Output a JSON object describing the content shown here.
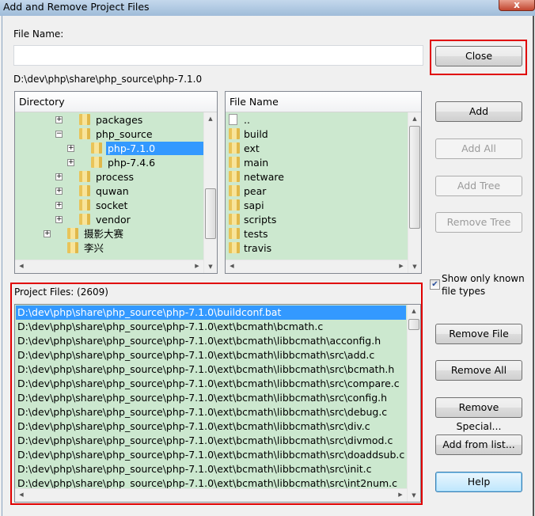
{
  "window": {
    "title": "Add and Remove Project Files",
    "close_glyph": "x"
  },
  "file_name": {
    "label": "File Name:",
    "value": ""
  },
  "current_path": "D:\\dev\\php\\share\\php_source\\php-7.1.0",
  "directory": {
    "header": "Directory",
    "items": [
      {
        "label": "packages",
        "level": 3,
        "expander": "+"
      },
      {
        "label": "php_source",
        "level": 3,
        "expander": "-"
      },
      {
        "label": "php-7.1.0",
        "level": 4,
        "expander": "+",
        "selected": true
      },
      {
        "label": "php-7.4.6",
        "level": 4,
        "expander": "+"
      },
      {
        "label": "process",
        "level": 3,
        "expander": "+"
      },
      {
        "label": "quwan",
        "level": 3,
        "expander": "+"
      },
      {
        "label": "socket",
        "level": 3,
        "expander": "+"
      },
      {
        "label": "vendor",
        "level": 3,
        "expander": "+"
      },
      {
        "label": "摄影大赛",
        "level": 2,
        "expander": "+"
      },
      {
        "label": "李兴",
        "level": 2,
        "expander": ""
      }
    ]
  },
  "files": {
    "header": "File Name",
    "items": [
      {
        "label": "..",
        "icon": "file"
      },
      {
        "label": "build",
        "icon": "folder"
      },
      {
        "label": "ext",
        "icon": "folder"
      },
      {
        "label": "main",
        "icon": "folder"
      },
      {
        "label": "netware",
        "icon": "folder"
      },
      {
        "label": "pear",
        "icon": "folder"
      },
      {
        "label": "sapi",
        "icon": "folder"
      },
      {
        "label": "scripts",
        "icon": "folder"
      },
      {
        "label": "tests",
        "icon": "folder"
      },
      {
        "label": "travis",
        "icon": "folder"
      }
    ]
  },
  "buttons": {
    "close": "Close",
    "add": "Add",
    "add_all": "Add All",
    "add_tree": "Add Tree",
    "remove_tree": "Remove Tree",
    "remove_file": "Remove File",
    "remove_all": "Remove All",
    "remove_special": "Remove Special...",
    "add_from_list": "Add from list...",
    "help": "Help"
  },
  "show_known": {
    "label_line1": "Show only known",
    "label_line2": "file types",
    "checked": true
  },
  "project_files": {
    "label": "Project Files: (2609)",
    "items": [
      "D:\\dev\\php\\share\\php_source\\php-7.1.0\\buildconf.bat",
      "D:\\dev\\php\\share\\php_source\\php-7.1.0\\ext\\bcmath\\bcmath.c",
      "D:\\dev\\php\\share\\php_source\\php-7.1.0\\ext\\bcmath\\libbcmath\\acconfig.h",
      "D:\\dev\\php\\share\\php_source\\php-7.1.0\\ext\\bcmath\\libbcmath\\src\\add.c",
      "D:\\dev\\php\\share\\php_source\\php-7.1.0\\ext\\bcmath\\libbcmath\\src\\bcmath.h",
      "D:\\dev\\php\\share\\php_source\\php-7.1.0\\ext\\bcmath\\libbcmath\\src\\compare.c",
      "D:\\dev\\php\\share\\php_source\\php-7.1.0\\ext\\bcmath\\libbcmath\\src\\config.h",
      "D:\\dev\\php\\share\\php_source\\php-7.1.0\\ext\\bcmath\\libbcmath\\src\\debug.c",
      "D:\\dev\\php\\share\\php_source\\php-7.1.0\\ext\\bcmath\\libbcmath\\src\\div.c",
      "D:\\dev\\php\\share\\php_source\\php-7.1.0\\ext\\bcmath\\libbcmath\\src\\divmod.c",
      "D:\\dev\\php\\share\\php_source\\php-7.1.0\\ext\\bcmath\\libbcmath\\src\\doaddsub.c",
      "D:\\dev\\php\\share\\php_source\\php-7.1.0\\ext\\bcmath\\libbcmath\\src\\init.c",
      "D:\\dev\\php\\share\\php_source\\php-7.1.0\\ext\\bcmath\\libbcmath\\src\\int2num.c"
    ]
  },
  "colors": {
    "list_bg": "#cce8cf",
    "selection": "#3399ff",
    "highlight_box": "#e00000"
  }
}
